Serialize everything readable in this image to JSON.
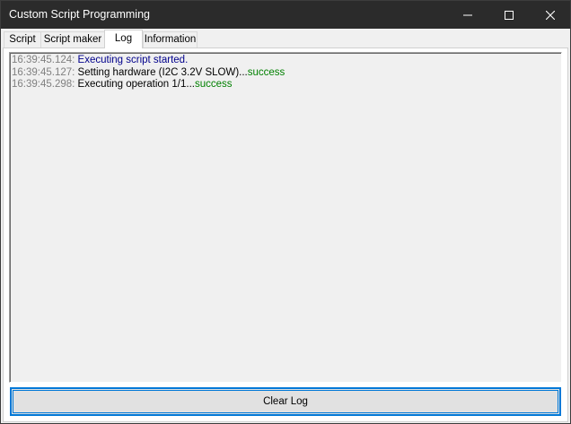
{
  "window": {
    "title": "Custom Script Programming"
  },
  "tabs": [
    {
      "label": "Script"
    },
    {
      "label": "Script maker"
    },
    {
      "label": "Log"
    },
    {
      "label": "Information"
    }
  ],
  "active_tab": "Log",
  "log": {
    "lines": [
      {
        "timestamp": "16:39:45.124:",
        "message": "Executing script started.",
        "status": ""
      },
      {
        "timestamp": "16:39:45.127:",
        "message": "Setting hardware (I2C 3.2V SLOW)...",
        "status": "success"
      },
      {
        "timestamp": "16:39:45.298:",
        "message": "Executing operation 1/1...",
        "status": "success"
      }
    ]
  },
  "buttons": {
    "clear_log": "Clear Log"
  },
  "icons": {
    "minimize": "minimize-icon",
    "maximize": "maximize-icon",
    "close": "close-icon"
  },
  "colors": {
    "titlebar": "#2b2b2b",
    "timestamp": "#808080",
    "info_message": "#00008b",
    "success": "#008000",
    "focus_border": "#0078d7"
  }
}
